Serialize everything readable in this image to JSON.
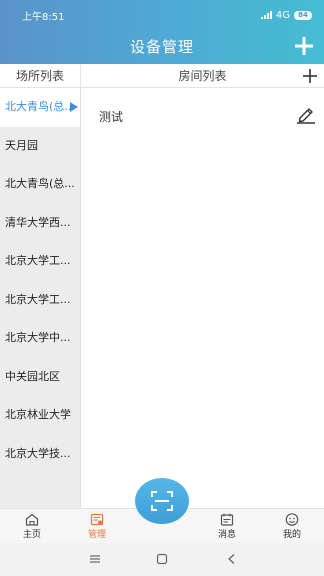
{
  "statusbar": {
    "time": "上午8:51",
    "network": "4G",
    "battery": "84"
  },
  "header": {
    "title": "设备管理"
  },
  "columns": {
    "sites": "场所列表",
    "rooms": "房间列表"
  },
  "sites": [
    {
      "label": "北大青鸟(总..."
    },
    {
      "label": "天月园"
    },
    {
      "label": "北大青鸟(总..."
    },
    {
      "label": "清华大学西..."
    },
    {
      "label": "北京大学工..."
    },
    {
      "label": "北京大学工..."
    },
    {
      "label": "北京大学中..."
    },
    {
      "label": "中关园北区"
    },
    {
      "label": "北京林业大学"
    },
    {
      "label": "北京大学技..."
    }
  ],
  "rooms": [
    {
      "name": "测试"
    }
  ],
  "tabs": [
    {
      "label": "主页",
      "icon": "home-icon"
    },
    {
      "label": "管理",
      "icon": "manage-icon"
    },
    {
      "label": "消息",
      "icon": "message-icon"
    },
    {
      "label": "我的",
      "icon": "profile-icon"
    }
  ],
  "colors": {
    "header_start": "#5a93c9",
    "header_end": "#46bdd2",
    "accent": "#3d8fe0",
    "active_tab": "#e8793a"
  }
}
